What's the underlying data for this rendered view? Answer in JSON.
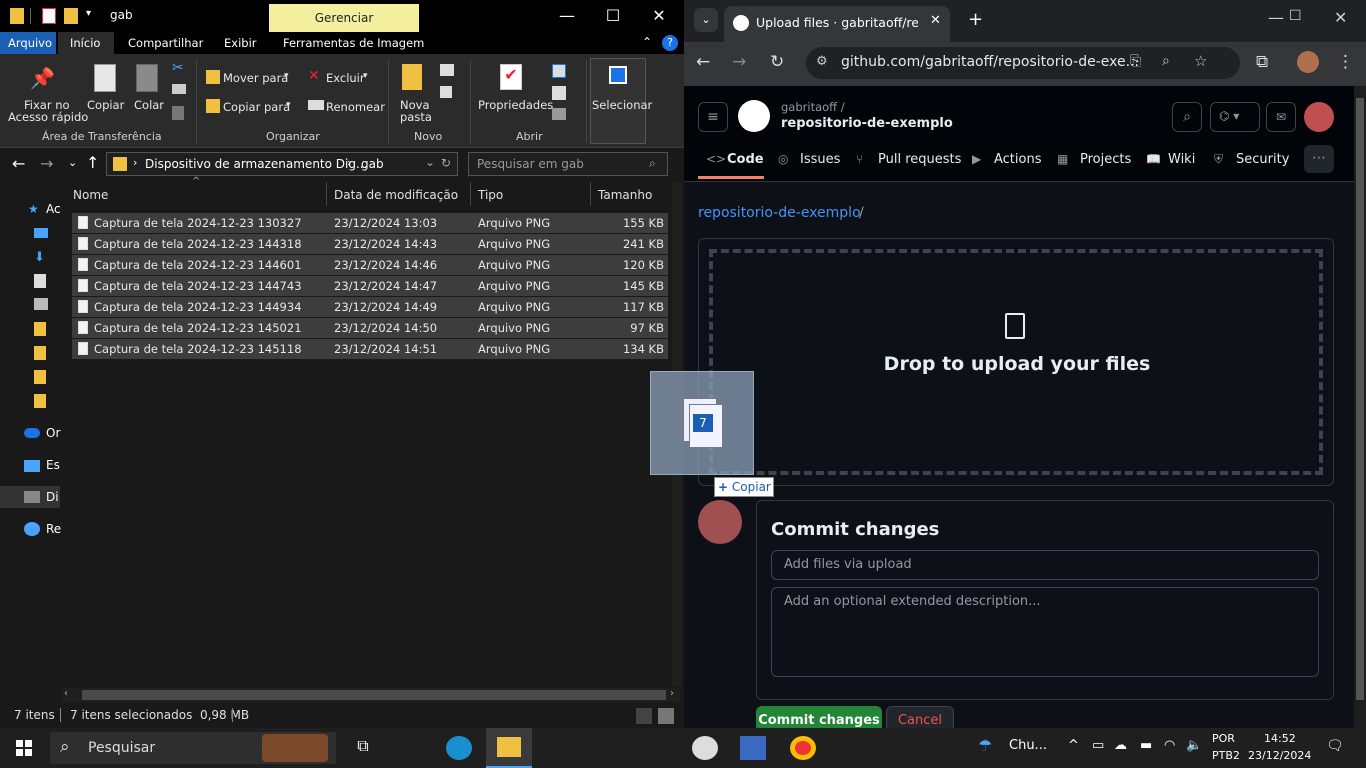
{
  "explorer": {
    "title": "gab",
    "manage_tab": "Gerenciar",
    "tabs": [
      "Arquivo",
      "Início",
      "Compartilhar",
      "Exibir",
      "Ferramentas de Imagem"
    ],
    "ribbon": {
      "pin": [
        "Fixar no",
        "Acesso rápido"
      ],
      "copy": "Copiar",
      "paste": "Colar",
      "move_to": "Mover para",
      "copy_to": "Copiar para",
      "delete": "Excluir",
      "rename": "Renomear",
      "new_folder": [
        "Nova",
        "pasta"
      ],
      "properties": "Propriedades",
      "select": "Selecionar",
      "groups": [
        "Área de Transferência",
        "Organizar",
        "Novo",
        "Abrir"
      ]
    },
    "address": {
      "segments": [
        "Dispositivo de armazenamento Dig...",
        "gab"
      ],
      "search_placeholder": "Pesquisar em gab"
    },
    "nav_labels": [
      "Ac",
      "Or",
      "Es",
      "Di",
      "Re"
    ],
    "columns": [
      "Nome",
      "Data de modificação",
      "Tipo",
      "Tamanho"
    ],
    "files": [
      {
        "name": "Captura de tela 2024-12-23 130327",
        "date": "23/12/2024 13:03",
        "type": "Arquivo PNG",
        "size": "155 KB"
      },
      {
        "name": "Captura de tela 2024-12-23 144318",
        "date": "23/12/2024 14:43",
        "type": "Arquivo PNG",
        "size": "241 KB"
      },
      {
        "name": "Captura de tela 2024-12-23 144601",
        "date": "23/12/2024 14:46",
        "type": "Arquivo PNG",
        "size": "120 KB"
      },
      {
        "name": "Captura de tela 2024-12-23 144743",
        "date": "23/12/2024 14:47",
        "type": "Arquivo PNG",
        "size": "145 KB"
      },
      {
        "name": "Captura de tela 2024-12-23 144934",
        "date": "23/12/2024 14:49",
        "type": "Arquivo PNG",
        "size": "117 KB"
      },
      {
        "name": "Captura de tela 2024-12-23 145021",
        "date": "23/12/2024 14:50",
        "type": "Arquivo PNG",
        "size": "97 KB"
      },
      {
        "name": "Captura de tela 2024-12-23 145118",
        "date": "23/12/2024 14:51",
        "type": "Arquivo PNG",
        "size": "134 KB"
      }
    ],
    "status": {
      "count": "7 itens",
      "selected": "7 itens selecionados  0,98 MB"
    }
  },
  "drag": {
    "count": "7",
    "tip": "Copiar"
  },
  "browser": {
    "tab_title": "Upload files · gabritaoff/reposit",
    "url": "github.com/gabritaoff/repositorio-de-exe...",
    "owner": "gabritaoff /",
    "repo": "repositorio-de-exemplo",
    "nav": [
      "Code",
      "Issues",
      "Pull requests",
      "Actions",
      "Projects",
      "Wiki",
      "Security"
    ],
    "breadcrumb_repo": "repositorio-de-exemplo",
    "breadcrumb_sep": "/",
    "drop_text": "Drop to upload your files",
    "commit_title": "Commit changes",
    "summary_placeholder": "Add files via upload",
    "desc_placeholder": "Add an optional extended description...",
    "commit_button": "Commit changes",
    "cancel_button": "Cancel"
  },
  "taskbar": {
    "search": "Pesquisar",
    "weather": "Chu...",
    "lang": [
      "POR",
      "PTB2"
    ],
    "time": "14:52",
    "date": "23/12/2024"
  }
}
